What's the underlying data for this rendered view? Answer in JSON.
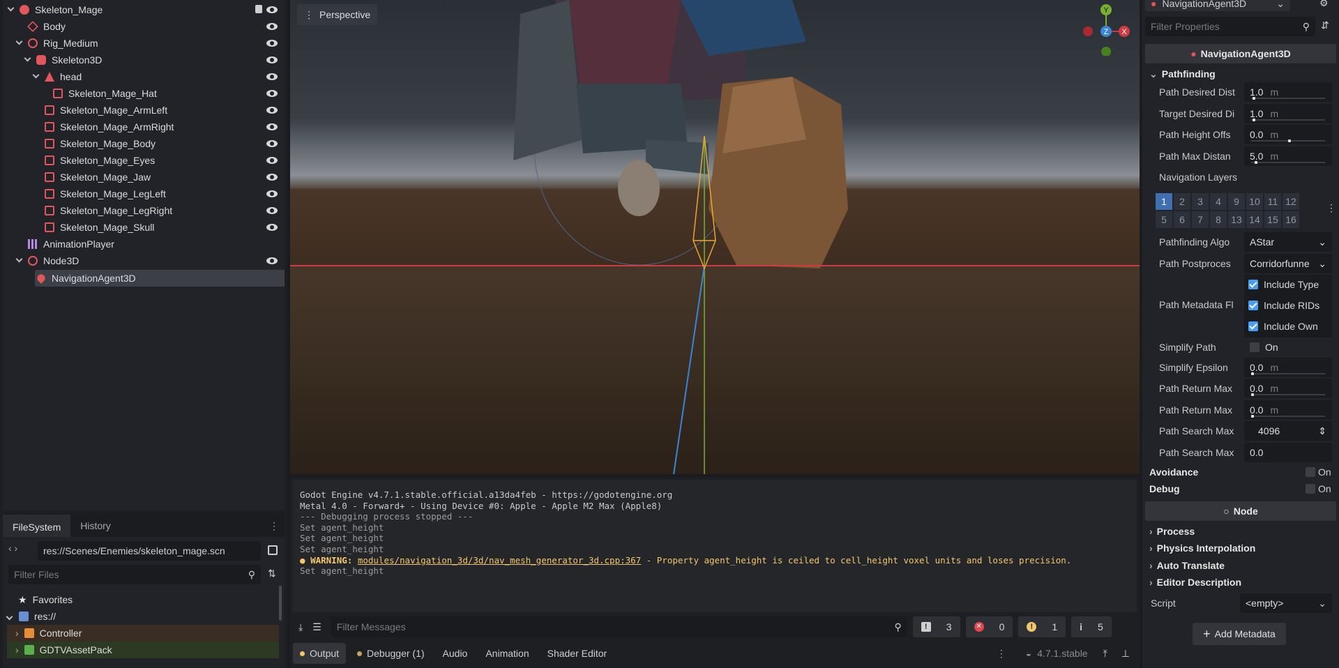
{
  "scene_tree": {
    "nodes": [
      {
        "label": "Skeleton_Mage"
      },
      {
        "label": "Body"
      },
      {
        "label": "Rig_Medium"
      },
      {
        "label": "Skeleton3D"
      },
      {
        "label": "head"
      },
      {
        "label": "Skeleton_Mage_Hat"
      },
      {
        "label": "Skeleton_Mage_ArmLeft"
      },
      {
        "label": "Skeleton_Mage_ArmRight"
      },
      {
        "label": "Skeleton_Mage_Body"
      },
      {
        "label": "Skeleton_Mage_Eyes"
      },
      {
        "label": "Skeleton_Mage_Jaw"
      },
      {
        "label": "Skeleton_Mage_LegLeft"
      },
      {
        "label": "Skeleton_Mage_LegRight"
      },
      {
        "label": "Skeleton_Mage_Skull"
      },
      {
        "label": "AnimationPlayer"
      },
      {
        "label": "Node3D"
      },
      {
        "label": "NavigationAgent3D"
      }
    ]
  },
  "filesystem": {
    "tabs": [
      "FileSystem",
      "History"
    ],
    "path": "res://Scenes/Enemies/skeleton_mage.scn",
    "filter_placeholder": "Filter Files",
    "items": [
      {
        "label": "Favorites"
      },
      {
        "label": "res://"
      },
      {
        "label": "Controller"
      },
      {
        "label": "GDTVAssetPack"
      }
    ]
  },
  "viewport": {
    "perspective_label": "Perspective",
    "gizmo": {
      "y": "Y",
      "z": "Z",
      "x": "X"
    }
  },
  "output": {
    "lines": [
      "Godot Engine v4.7.1.stable.official.a13da4feb - https://godotengine.org",
      "Metal 4.0 - Forward+ - Using Device #0: Apple - Apple M2 Max (Apple8)",
      "",
      "--- Debugging process stopped ---",
      "Set agent_height",
      "Set agent_height",
      "Set agent_height"
    ],
    "warning_label": "WARNING:",
    "warning_link": "modules/navigation_3d/3d/nav_mesh_generator_3d.cpp:367",
    "warning_text": " - Property agent_height is ceiled to cell_height voxel units and loses precision.",
    "last_line": "Set agent_height",
    "filter_placeholder": "Filter Messages",
    "counts": {
      "messages": "3",
      "errors": "0",
      "warnings": "1",
      "info": "5"
    }
  },
  "bottom_tabs": [
    "Output",
    "Debugger (1)",
    "Audio",
    "Animation",
    "Shader Editor"
  ],
  "version": "4.7.1.stable",
  "inspector": {
    "node_type": "NavigationAgent3D",
    "filter_placeholder": "Filter Properties",
    "header": "NavigationAgent3D",
    "section_pathfinding": "Pathfinding",
    "props": {
      "path_desired_dist": {
        "label": "Path Desired Dist",
        "value": "1.0",
        "unit": "m",
        "slider": 0.02
      },
      "target_desired_dist": {
        "label": "Target Desired Di",
        "value": "1.0",
        "unit": "m",
        "slider": 0.02
      },
      "path_height_offset": {
        "label": "Path Height Offs",
        "value": "0.0",
        "unit": "m",
        "slider": 0.5
      },
      "path_max_distance": {
        "label": "Path Max Distan",
        "value": "5.0",
        "unit": "m",
        "slider": 0.05
      },
      "navigation_layers": {
        "label": "Navigation Layers"
      },
      "pathfinding_algo": {
        "label": "Pathfinding Algo",
        "value": "AStar"
      },
      "path_postprocess": {
        "label": "Path Postproces",
        "value": "Corridorfunne"
      },
      "path_metadata": {
        "label": "Path Metadata Fl",
        "options": [
          "Include Type",
          "Include RIDs",
          "Include Own"
        ]
      },
      "simplify_path": {
        "label": "Simplify Path",
        "value": "On"
      },
      "simplify_epsilon": {
        "label": "Simplify Epsilon",
        "value": "0.0",
        "unit": "m",
        "slider": 0.0
      },
      "path_return_max_1": {
        "label": "Path Return Max",
        "value": "0.0",
        "unit": "m",
        "slider": 0.0
      },
      "path_return_max_2": {
        "label": "Path Return Max",
        "value": "0.0",
        "unit": "m",
        "slider": 0.0
      },
      "path_search_max_1": {
        "label": "Path Search Max",
        "value": "4096"
      },
      "path_search_max_2": {
        "label": "Path Search Max",
        "value": "0.0"
      }
    },
    "layers": [
      "1",
      "2",
      "3",
      "4",
      "9",
      "10",
      "11",
      "12",
      "5",
      "6",
      "7",
      "8",
      "13",
      "14",
      "15",
      "16"
    ],
    "avoidance": {
      "label": "Avoidance",
      "value": "On"
    },
    "debug": {
      "label": "Debug",
      "value": "On"
    },
    "node_header": "Node",
    "sections": [
      "Process",
      "Physics Interpolation",
      "Auto Translate",
      "Editor Description"
    ],
    "script": {
      "label": "Script",
      "value": "<empty>"
    },
    "add_metadata": "Add Metadata"
  },
  "colors": {
    "accent": "#4a9ef0",
    "warning": "#f3c66b",
    "selection": "#3d3f46",
    "error": "#e0484e"
  }
}
